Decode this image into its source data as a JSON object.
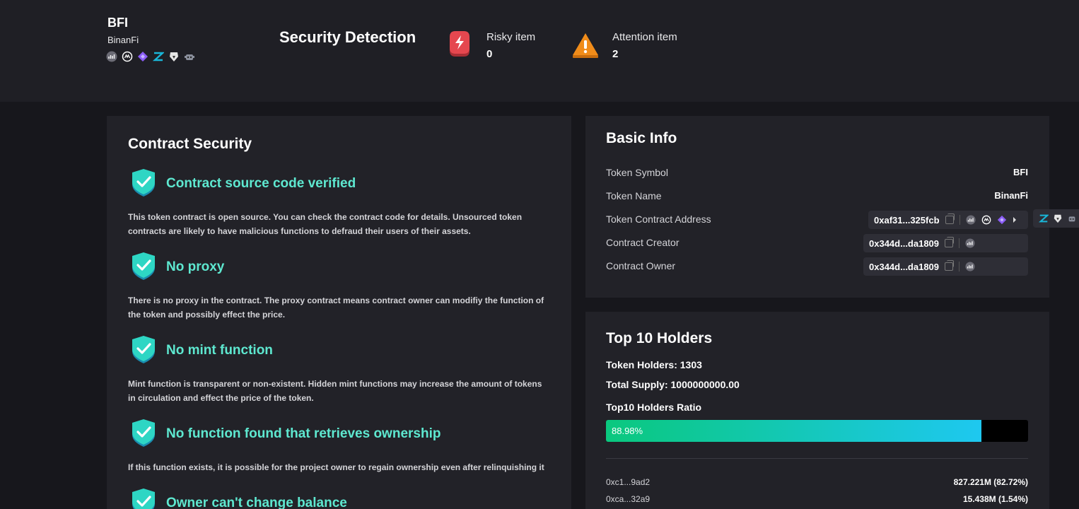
{
  "header": {
    "token_symbol": "BFI",
    "token_name": "BinanFi",
    "token_icons": [
      "explorer-icon",
      "coinmarketcap-icon",
      "diamond-icon",
      "zapper-icon",
      "lion-icon",
      "bot-icon"
    ],
    "title": "Security Detection",
    "risky_label": "Risky item",
    "risky_count": "0",
    "attention_label": "Attention item",
    "attention_count": "2"
  },
  "contract_security": {
    "title": "Contract Security",
    "items": [
      {
        "title": "Contract source code verified",
        "desc": "This token contract is open source. You can check the contract code for details. Unsourced token contracts are likely to have malicious functions to defraud their users of their assets."
      },
      {
        "title": "No proxy",
        "desc": "There is no proxy in the contract. The proxy contract means contract owner can modifiy the function of the token and possibly effect the price."
      },
      {
        "title": "No mint function",
        "desc": "Mint function is transparent or non-existent. Hidden mint functions may increase the amount of tokens in circulation and effect the price of the token."
      },
      {
        "title": "No function found that retrieves ownership",
        "desc": "If this function exists, it is possible for the project owner to regain ownership even after relinquishing it"
      },
      {
        "title": "Owner can't change balance",
        "desc": ""
      }
    ]
  },
  "basic_info": {
    "title": "Basic Info",
    "symbol_label": "Token Symbol",
    "symbol_value": "BFI",
    "name_label": "Token Name",
    "name_value": "BinanFi",
    "address_label": "Token Contract Address",
    "address_value": "0xaf31...325fcb",
    "creator_label": "Contract Creator",
    "creator_value": "0x344d...da1809",
    "owner_label": "Contract Owner",
    "owner_value": "0x344d...da1809"
  },
  "holders": {
    "title": "Top 10 Holders",
    "holders_count": "Token Holders: 1303",
    "total_supply": "Total Supply: 1000000000.00",
    "ratio_label": "Top10 Holders Ratio",
    "ratio_text": "88.98%",
    "ratio_value": 88.98,
    "rows": [
      {
        "address": "0xc1...9ad2",
        "amount": "827.221M  (82.72%)"
      },
      {
        "address": "0xca...32a9",
        "amount": "15.438M  (1.54%)"
      }
    ]
  },
  "colors": {
    "accent_teal": "#5ee8d0",
    "risk_red": "#e5474f",
    "warn_orange": "#f08c1a"
  }
}
